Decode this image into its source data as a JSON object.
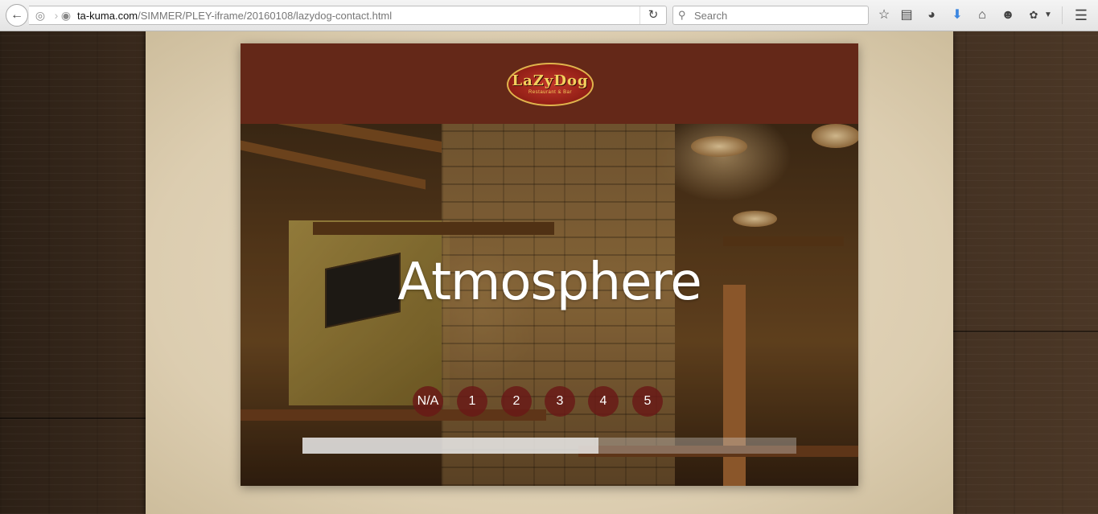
{
  "browser": {
    "url_host": "ta-kuma.com",
    "url_path": "/SIMMER/PLEY-iframe/20160108/lazydog-contact.html",
    "search_placeholder": "Search"
  },
  "header": {
    "logo_text": "LaZyDog",
    "logo_subtext": "Restaurant & Bar"
  },
  "hero": {
    "title": "Atmosphere",
    "rating_options": [
      "N/A",
      "1",
      "2",
      "3",
      "4",
      "5"
    ],
    "progress_fraction": 0.6
  },
  "colors": {
    "header_bg": "#642818",
    "rating_button": "#691916"
  }
}
